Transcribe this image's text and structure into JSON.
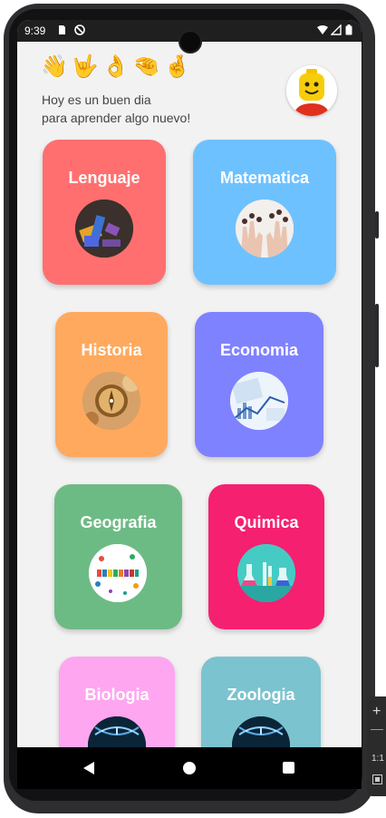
{
  "status_bar": {
    "time": "9:39",
    "icons": [
      "sd-card-icon",
      "do-not-disturb-icon",
      "wifi-icon",
      "signal-icon",
      "battery-icon"
    ]
  },
  "header": {
    "emojis": "👋🤟👌🤏🤞",
    "greeting_line1": "Hoy es un buen dia",
    "greeting_line2": "para aprender algo nuevo!",
    "avatar": "lego-avatar"
  },
  "subjects": [
    {
      "label": "Lenguaje",
      "color": "#FF6F6F",
      "image": "letters-image"
    },
    {
      "label": "Matematica",
      "color": "#6EC1FF",
      "image": "hands-numbers-image"
    },
    {
      "label": "Historia",
      "color": "#FFA95E",
      "image": "compass-image"
    },
    {
      "label": "Economia",
      "color": "#7F82FF",
      "image": "finance-charts-image"
    },
    {
      "label": "Geografia",
      "color": "#6DBB84",
      "image": "geography-image"
    },
    {
      "label": "Quimica",
      "color": "#F52070",
      "image": "lab-image"
    },
    {
      "label": "Biologia",
      "color": "#FFA6F0",
      "image": "dna-image"
    },
    {
      "label": "Zoologia",
      "color": "#7BC3CF",
      "image": "dna-image"
    }
  ],
  "emulator_toolbar": {
    "zoom_label": "1:1",
    "plus_label": "+"
  }
}
